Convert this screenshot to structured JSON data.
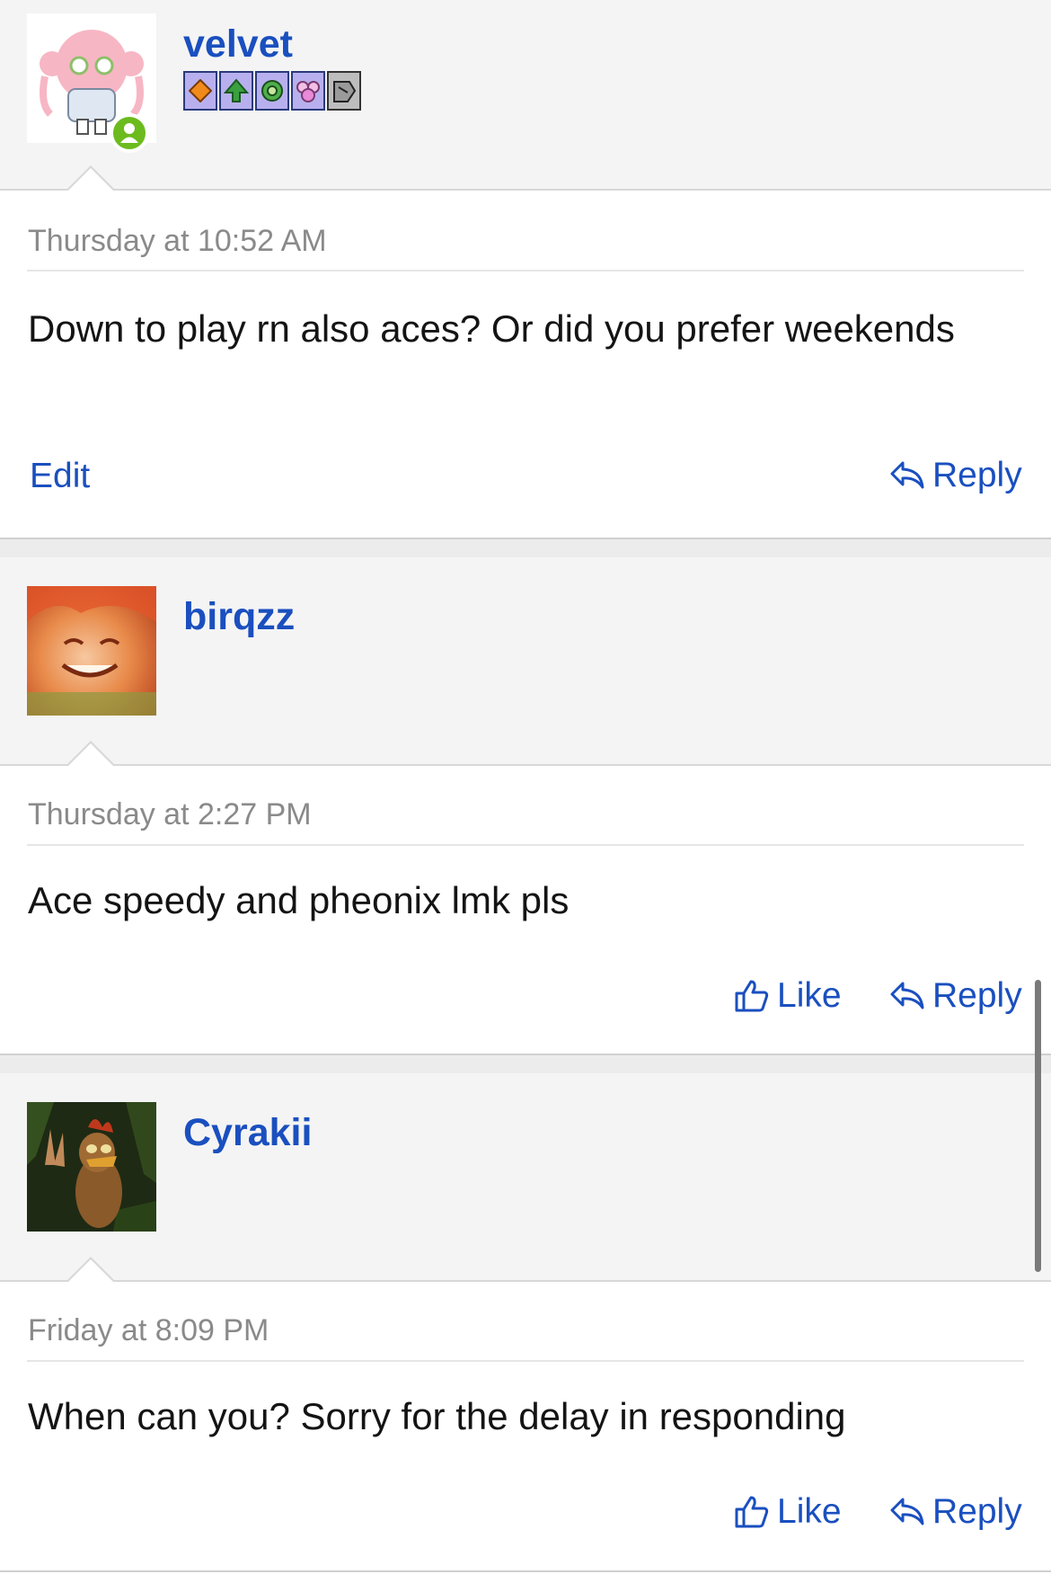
{
  "posts": [
    {
      "username": "velvet",
      "online": true,
      "badges": [
        "orange-diamond-badge",
        "green-arrows-badge",
        "green-gear-badge",
        "pink-flower-badge",
        "grey-shield-badge"
      ],
      "timestamp": "Thursday at 10:52 AM",
      "message": "Down to play rn also aces? Or did you prefer weekends",
      "actions": {
        "edit": "Edit",
        "reply": "Reply"
      }
    },
    {
      "username": "birqzz",
      "timestamp": "Thursday at 2:27 PM",
      "message": "Ace speedy and pheonix lmk pls",
      "actions": {
        "like": "Like",
        "reply": "Reply"
      }
    },
    {
      "username": "Cyrakii",
      "timestamp": "Friday at 8:09 PM",
      "message": "When can you? Sorry for the delay in responding",
      "actions": {
        "like": "Like",
        "reply": "Reply"
      }
    }
  ],
  "colors": {
    "link": "#1a4fbf",
    "header_bg": "#f4f4f4",
    "online": "#6cbb1e",
    "timestamp": "#8a8a8a"
  }
}
